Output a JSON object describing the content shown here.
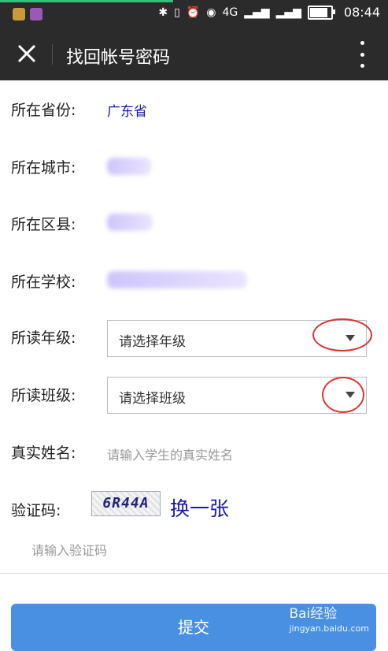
{
  "statusbar": {
    "time": "08:44",
    "network": "4G"
  },
  "header": {
    "title": "找回帐号密码"
  },
  "form": {
    "province_label": "所在省份:",
    "province_value": "广东省",
    "city_label": "所在城市:",
    "district_label": "所在区县:",
    "school_label": "所在学校:",
    "grade_label": "所读年级:",
    "grade_select": "请选择年级",
    "class_label": "所读班级:",
    "class_select": "请选择班级",
    "name_label": "真实姓名:",
    "name_placeholder": "请输入学生的真实姓名",
    "captcha_label": "验证码:",
    "captcha_code": "6R44A",
    "captcha_refresh": "换一张",
    "captcha_placeholder": "请输入验证码",
    "submit_label": "提交"
  },
  "watermark": {
    "brand": "Bai经验",
    "url": "jingyan.baidu.com"
  }
}
